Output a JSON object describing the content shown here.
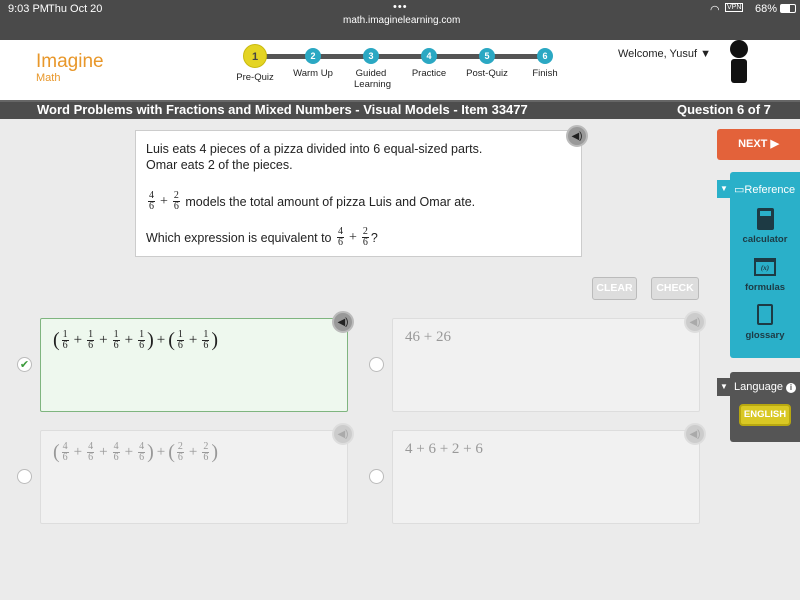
{
  "status_bar": {
    "time": "9:03 PM",
    "date": "Thu Oct 20",
    "url": "math.imaginelearning.com",
    "battery": "68%",
    "vpn": "VPN"
  },
  "brand": {
    "name": "Imagine",
    "sub": "Math",
    "color": "#e8972a"
  },
  "steps": [
    {
      "num": "1",
      "label": "Pre-Quiz",
      "current": true
    },
    {
      "num": "2",
      "label": "Warm Up"
    },
    {
      "num": "3",
      "label": "Guided Learning"
    },
    {
      "num": "4",
      "label": "Practice"
    },
    {
      "num": "5",
      "label": "Post-Quiz"
    },
    {
      "num": "6",
      "label": "Finish"
    }
  ],
  "user": {
    "welcome": "Welcome, Yusuf"
  },
  "title": {
    "lesson": "Word Problems with Fractions and Mixed Numbers - Visual Models - Item 33477",
    "progress": "Question 6 of 7"
  },
  "question": {
    "line1": "Luis eats 4 pieces of a pizza divided into 6 equal-sized parts.",
    "line2": "Omar eats 2 of the pieces.",
    "model_text": "models the total amount of pizza Luis and Omar ate.",
    "prompt": "Which expression is equivalent to",
    "prompt_end": "?",
    "expr": [
      [
        "4",
        "6"
      ],
      "+",
      [
        "2",
        "6"
      ]
    ]
  },
  "buttons": {
    "clear": "CLEAR",
    "check": "CHECK",
    "next": "NEXT ▶"
  },
  "options": [
    {
      "id": "A",
      "selected": true,
      "expr": [
        "(",
        [
          "1",
          "6"
        ],
        "+",
        [
          "1",
          "6"
        ],
        "+",
        [
          "1",
          "6"
        ],
        "+",
        [
          "1",
          "6"
        ],
        ")",
        "+",
        "(",
        [
          "1",
          "6"
        ],
        "+",
        [
          "1",
          "6"
        ],
        ")"
      ]
    },
    {
      "id": "B",
      "selected": false,
      "expr": [
        "46 + 26"
      ]
    },
    {
      "id": "C",
      "selected": false,
      "expr": [
        "(",
        [
          "4",
          "6"
        ],
        "+",
        [
          "4",
          "6"
        ],
        "+",
        [
          "4",
          "6"
        ],
        "+",
        [
          "4",
          "6"
        ],
        ")",
        "+",
        "(",
        [
          "2",
          "6"
        ],
        "+",
        [
          "2",
          "6"
        ],
        ")"
      ]
    },
    {
      "id": "D",
      "selected": false,
      "expr": [
        "4 + 6 + 2 + 6"
      ]
    }
  ],
  "reference": {
    "title": "Reference",
    "items": [
      "calculator",
      "formulas",
      "glossary"
    ],
    "formula_glyph": "(x)",
    "color": "#2ab0c9"
  },
  "language": {
    "title": "Language",
    "value": "ENGLISH"
  }
}
